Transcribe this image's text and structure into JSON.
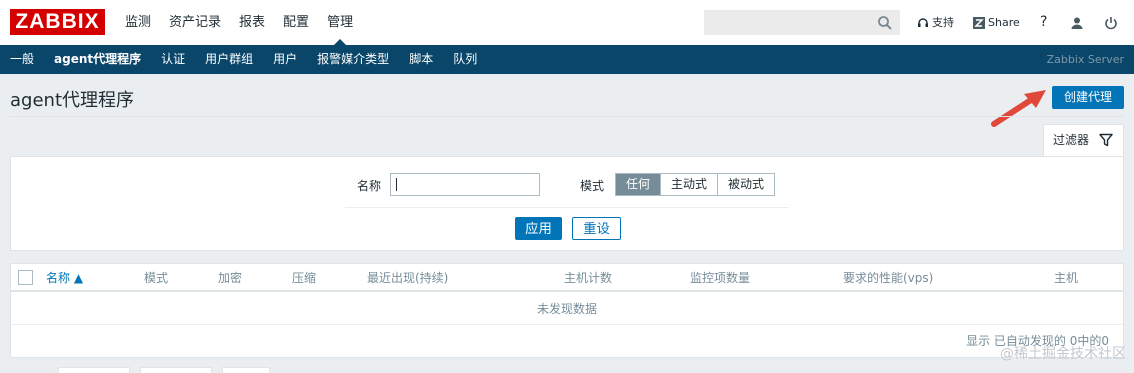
{
  "topbar": {
    "logo": "ZABBIX",
    "nav": [
      "监测",
      "资产记录",
      "报表",
      "配置",
      "管理"
    ],
    "active_index": 4,
    "search_value": "",
    "support_label": "支持",
    "share_label": "Share",
    "help_label": "?"
  },
  "subbar": {
    "items": [
      "一般",
      "agent代理程序",
      "认证",
      "用户群组",
      "用户",
      "报警媒介类型",
      "脚本",
      "队列"
    ],
    "active_index": 1,
    "server_name": "Zabbix Server"
  },
  "header": {
    "title": "agent代理程序",
    "create_button": "创建代理"
  },
  "filter": {
    "tab_label": "过滤器",
    "name_label": "名称",
    "name_value": "",
    "mode_label": "模式",
    "mode_options": [
      "任何",
      "主动式",
      "被动式"
    ],
    "mode_selected": 0,
    "apply_label": "应用",
    "reset_label": "重设"
  },
  "table": {
    "columns": [
      "名称 ▲",
      "模式",
      "加密",
      "压缩",
      "最近出现(持续)",
      "主机计数",
      "监控项数量",
      "要求的性能(vps)",
      "主机"
    ],
    "sorted_column": 0,
    "empty_text": "未发现数据",
    "footer": "显示 已自动发现的 0中的0"
  },
  "watermark": "@稀土掘金技术社区",
  "colors": {
    "brand_red": "#d40000",
    "nav_blue": "#0a466a",
    "accent_blue": "#0275b8",
    "arrow_red": "#e0493a"
  }
}
